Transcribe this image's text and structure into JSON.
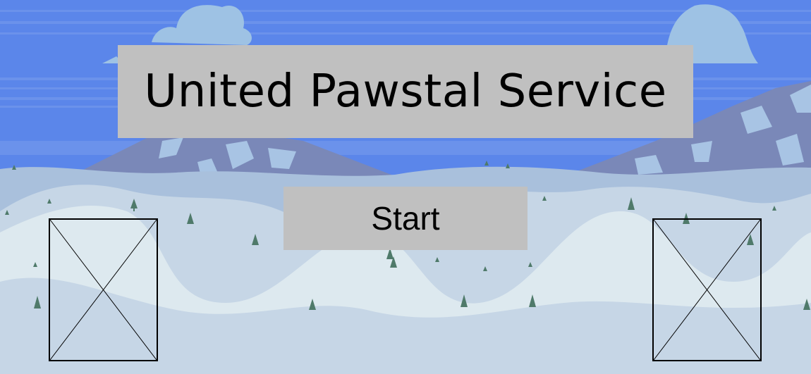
{
  "game": {
    "title": "United Pawstal Service",
    "start_label": "Start"
  },
  "images": {
    "left_image": "broken-image-placeholder",
    "right_image": "broken-image-placeholder"
  },
  "colors": {
    "sky": "#5b86ea",
    "sky_band": "#6f95ec",
    "cloud": "#9ec2e4",
    "mountain": "#7a88b8",
    "mountain_snow": "#a8c4e4",
    "snow_far": "#a9c0dc",
    "snow_mid": "#c6d6e6",
    "snow_light": "#dde9ef",
    "button_bg": "#c0c0c0"
  }
}
